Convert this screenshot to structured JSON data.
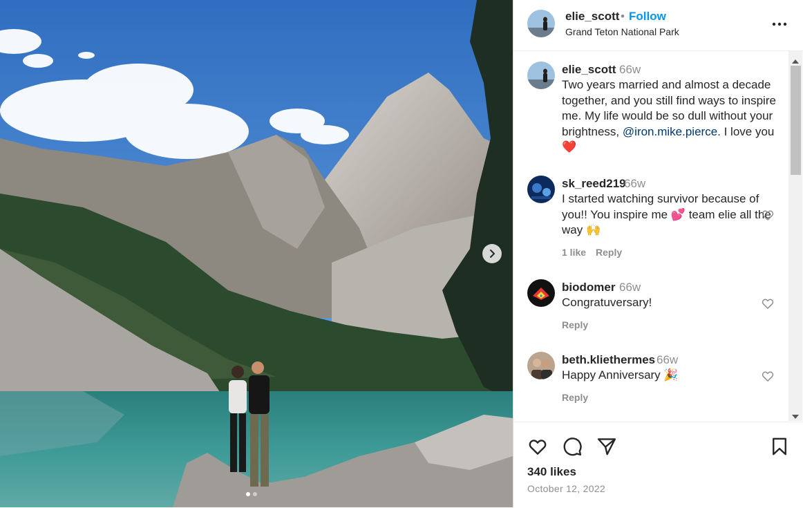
{
  "post": {
    "author": "elie_scott",
    "separator": "•",
    "follow_label": "Follow",
    "location": "Grand Teton National Park",
    "caption": {
      "user": "elie_scott",
      "time": "66w",
      "text_before": "Two years married and almost a decade together, and you still find ways to inspire me. My life would be so dull without your brightness,",
      "mention": "@iron.mike.pierce",
      "text_after": ". I love you ❤️"
    },
    "likes": "340 likes",
    "date": "October 12, 2022",
    "photo": {
      "current_slide": 1,
      "slide_count": 2
    }
  },
  "comments": [
    {
      "user": "sk_reed219",
      "time": "66w",
      "text": "I started watching survivor because of you!! You inspire me 💕 team elie all the way 🙌",
      "likes": "1 like",
      "reply_label": "Reply"
    },
    {
      "user": "biodomer",
      "time": "66w",
      "text": "Congratuversary!",
      "reply_label": "Reply"
    },
    {
      "user": "beth.kliethermes",
      "time": "66w",
      "text": "Happy Anniversary 🎉",
      "reply_label": "Reply"
    }
  ],
  "icons": {
    "more": "more-options-icon",
    "next": "chevron-right-icon",
    "like": "heart-icon",
    "comment": "comment-icon",
    "share": "send-icon",
    "save": "bookmark-icon"
  },
  "colors": {
    "link": "#0095f6",
    "mention": "#00376b",
    "muted": "#8e8e8e",
    "text": "#262626",
    "heart": "#ed4956"
  }
}
